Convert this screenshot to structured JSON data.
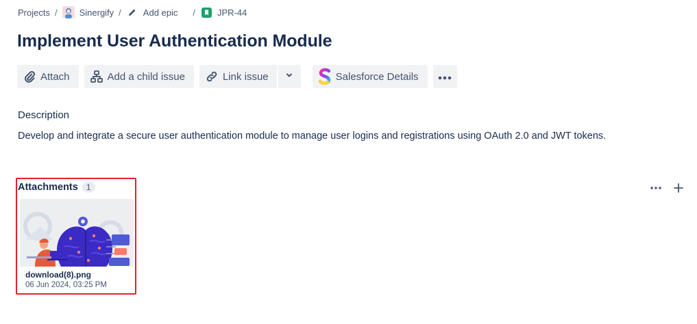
{
  "breadcrumb": {
    "items": [
      {
        "label": "Projects"
      },
      {
        "label": "Sinergify",
        "icon": "project-avatar-icon"
      },
      {
        "label": "Add epic",
        "icon": "pencil-icon"
      },
      {
        "label": "JPR-44",
        "icon": "story-icon"
      }
    ],
    "separator": "/"
  },
  "issue": {
    "title": "Implement User Authentication Module"
  },
  "toolbar": {
    "attach": "Attach",
    "add_child": "Add a child issue",
    "link_issue": "Link issue",
    "salesforce": "Salesforce Details"
  },
  "description": {
    "label": "Description",
    "text": "Develop and integrate a secure user authentication module to manage user logins and registrations using OAuth 2.0 and JWT tokens."
  },
  "attachments": {
    "label": "Attachments",
    "count": "1",
    "files": [
      {
        "name": "download(8).png",
        "date": "06 Jun 2024, 03:25 PM"
      }
    ]
  },
  "colors": {
    "text_primary": "#172b4d",
    "text_subtle": "#44546f",
    "button_bg": "#f1f2f4",
    "highlight": "#e2212a",
    "story_green": "#22a06b"
  }
}
